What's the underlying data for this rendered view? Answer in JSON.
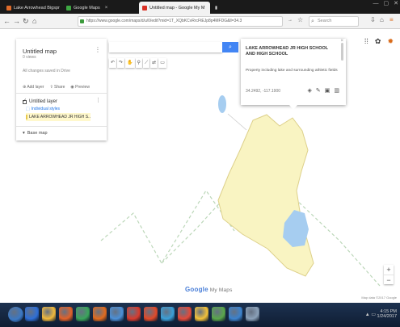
{
  "browser": {
    "tabs": [
      {
        "label": "Lake Arrowhead Bigspr",
        "favicon_color": "#e06c2b"
      },
      {
        "label": "Google Maps",
        "favicon_color": "#3ea843"
      },
      {
        "label": "Untitled map - Google My M",
        "favicon_color": "#d93025"
      }
    ],
    "window_controls": [
      "—",
      "▢",
      "✕"
    ],
    "address": "https://www.google.com/maps/d/u/0/edit?mid=1T_XQbKCvRrcFtEJp8p4MFDG&ll=34.3",
    "search_placeholder": "Search",
    "icons": [
      "back-icon",
      "forward-icon",
      "reload-icon",
      "home-icon",
      "lock-icon",
      "star-icon",
      "search-icon",
      "download-icon",
      "menu-icon"
    ]
  },
  "map": {
    "panel": {
      "title": "Untitled map",
      "subtitle": "0 views",
      "last_edit": "All changes saved in Drive",
      "actions": [
        "Add layer",
        "Share",
        "Preview"
      ],
      "layer_name": "Untitled layer",
      "style_link": "Individual styles",
      "feature_label": "LAKE ARROWHEAD JR HIGH S...",
      "basemap_label": "Base map"
    },
    "search_button_icon": "search-icon",
    "tool_icons": [
      "undo-icon",
      "redo-icon",
      "hand-icon",
      "marker-icon",
      "line-icon",
      "directions-icon",
      "ruler-icon"
    ],
    "popup": {
      "title": "LAKE ARROWHEAD JR HIGH SCHOOL AND HIGH SCHOOL",
      "description": "Property including lake and surrounding athletic fields",
      "coords": "34.2492, -117.1900",
      "tools": [
        "style-icon",
        "edit-icon",
        "image-icon",
        "delete-icon"
      ]
    },
    "right_tools": [
      "grid-icon",
      "settings-icon",
      "google-apps-icon"
    ],
    "zoom": {
      "in": "+",
      "out": "−"
    },
    "logo": {
      "text": "Google",
      "suffix": " My Maps"
    },
    "attribution": "Map data ©2017 Google",
    "colors": {
      "polygon_fill": "#f9f4c2",
      "polygon_stroke": "#ddd08a",
      "water": "#a6cdf0",
      "road": "#bcd7b9"
    }
  },
  "taskbar": {
    "app_icons": [
      {
        "name": "start-orb",
        "color": "#3b78c4"
      },
      {
        "name": "ie",
        "color": "#2f6fd6"
      },
      {
        "name": "explorer",
        "color": "#f0b83c"
      },
      {
        "name": "media",
        "color": "#e0612a"
      },
      {
        "name": "chrome",
        "color": "#3aa55b"
      },
      {
        "name": "firefox",
        "color": "#e06b1f"
      },
      {
        "name": "app7",
        "color": "#4b8fd6"
      },
      {
        "name": "app8",
        "color": "#d73b2e"
      },
      {
        "name": "app9",
        "color": "#e04a2a"
      },
      {
        "name": "app10",
        "color": "#3b9ed6"
      },
      {
        "name": "app11",
        "color": "#e24a3b"
      },
      {
        "name": "app12",
        "color": "#f2c13a"
      },
      {
        "name": "app13",
        "color": "#5aa64b"
      },
      {
        "name": "app14",
        "color": "#3c82cc"
      },
      {
        "name": "app15",
        "color": "#8aa0b8"
      }
    ],
    "tray_icons": "▲ ▭",
    "time": "4:15 PM",
    "date": "1/24/2017"
  }
}
